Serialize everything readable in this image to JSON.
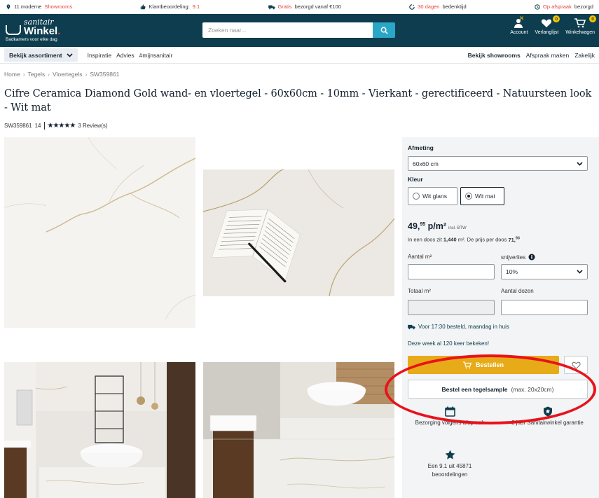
{
  "topbar": {
    "item1_pre": "11 moderne",
    "item1_hl": "Showrooms",
    "item2_pre": "Klantbeoordeling:",
    "item2_hl": "9.1",
    "item3_hl": "Gratis",
    "item3_post": "bezorgd vanaf €100",
    "item4_hl": "30 dagen",
    "item4_post": "bedenktijd",
    "item5_hl": "Op afspraak",
    "item5_post": "bezorgd"
  },
  "header": {
    "brand_top": "sanitair",
    "brand_main": "Winkel",
    "brand_dot": ".",
    "tagline": "Badkamers voor elke dag",
    "search_placeholder": "Zoeken naar...",
    "account_label": "Account",
    "wishlist_label": "Verlanglijst",
    "wishlist_count": "0",
    "cart_label": "Winkelwagen",
    "cart_count": "0"
  },
  "nav": {
    "assortment": "Bekijk assortiment",
    "items": [
      "Inspiratie",
      "Advies",
      "#mijnsanitair"
    ],
    "showrooms": "Bekijk showrooms",
    "appointment": "Afspraak maken",
    "business": "Zakelijk"
  },
  "breadcrumb": [
    "Home",
    "Tegels",
    "Vloertegels",
    "SW359861"
  ],
  "product": {
    "title": "Cifre Ceramica Diamond Gold wand- en vloertegel - 60x60cm - 10mm - Vierkant - gerectificeerd - Natuursteen look - Wit mat",
    "sku": "SW359861",
    "sku_suffix": "14",
    "rating_stars": "★★★★★",
    "reviews": "3 Review(s)"
  },
  "panel": {
    "size_label": "Afmeting",
    "size_value": "60x60 cm",
    "color_label": "Kleur",
    "color_options": [
      "Wit glans",
      "Wit mat"
    ],
    "color_selected": "Wit mat",
    "price_main": "49,",
    "price_cents": "95",
    "price_unit": " p/m²",
    "price_incl": "incl. BTW",
    "box_text_pre": "In een doos zit ",
    "box_qty": "1,440",
    "box_text_mid": " m². De prijs per doos ",
    "box_price": "71,",
    "box_price_cents": "93",
    "qty_label": "Aantal m²",
    "loss_label": "snijverlies",
    "loss_value": "10%",
    "total_label": "Totaal m²",
    "boxes_label": "Aantal dozen",
    "delivery": "Voor 17:30 besteld, maandag in huis",
    "viewed": "Deze week al 120 keer bekeken!",
    "order_button": "Bestellen",
    "sample_button": "Bestel een tegelsample",
    "sample_size": "(max. 20x20cm)",
    "usp1": "Bezorging volgens afspraak",
    "usp2": "2 jaar Sanitairwinkel garantie",
    "usp3": "Een 9.1 uit 45871 beoordelingen"
  },
  "colors": {
    "header_bg": "#0d3d4e",
    "accent_blue": "#2aa6c7",
    "order_yellow": "#e7aa18",
    "highlight_red": "#e2453c",
    "annotation_red": "#e8131b"
  }
}
